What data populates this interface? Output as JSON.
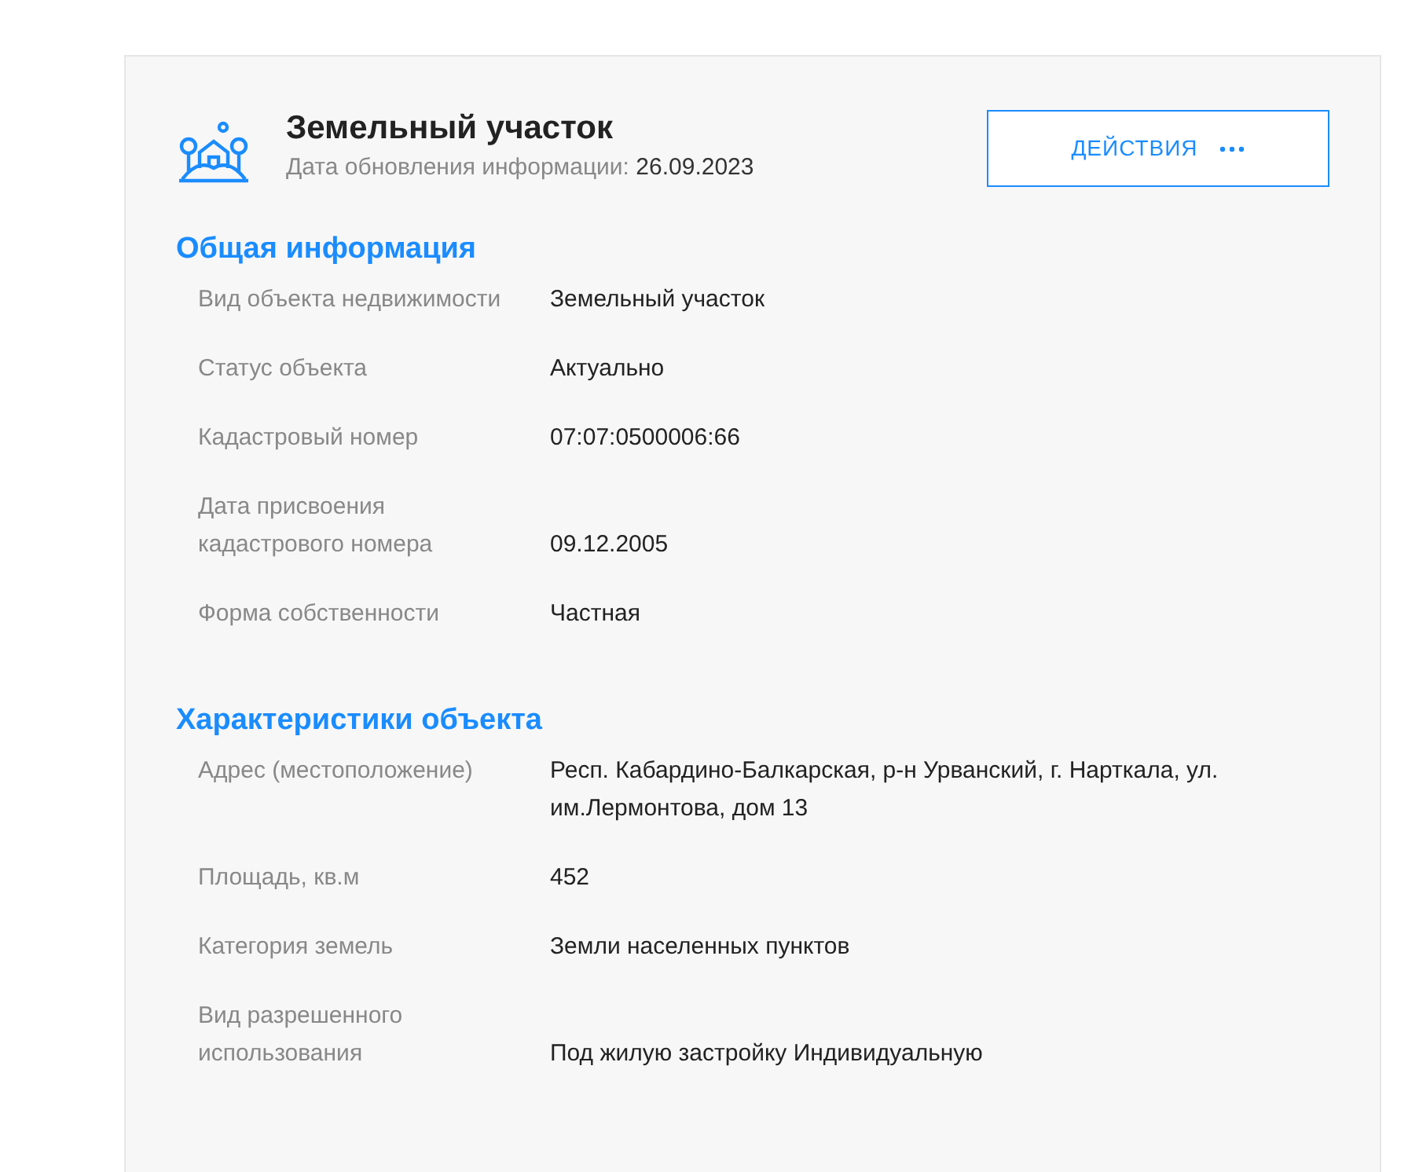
{
  "header": {
    "title": "Земельный участок",
    "update_label": "Дата обновления информации:",
    "update_date": "26.09.2023",
    "actions_button": "ДЕЙСТВИЯ"
  },
  "sections": [
    {
      "title": "Общая информация",
      "rows": [
        {
          "label": "Вид объекта недвижимости",
          "value": "Земельный участок"
        },
        {
          "label": "Статус объекта",
          "value": "Актуально"
        },
        {
          "label": "Кадастровый номер",
          "value": "07:07:0500006:66"
        },
        {
          "label": "Дата присвоения кадастрового номера",
          "value": "09.12.2005"
        },
        {
          "label": "Форма собственности",
          "value": "Частная"
        }
      ]
    },
    {
      "title": "Характеристики объекта",
      "rows": [
        {
          "label": "Адрес (местоположение)",
          "value": "Респ. Кабардино-Балкарская, р-н Урванский, г. Нарткала, ул. им.Лермонтова, дом 13"
        },
        {
          "label": "Площадь, кв.м",
          "value": "452"
        },
        {
          "label": "Категория земель",
          "value": "Земли населенных пунктов"
        },
        {
          "label": "Вид разрешенного использования",
          "value": "Под жилую застройку Индивидуальную"
        }
      ]
    }
  ]
}
